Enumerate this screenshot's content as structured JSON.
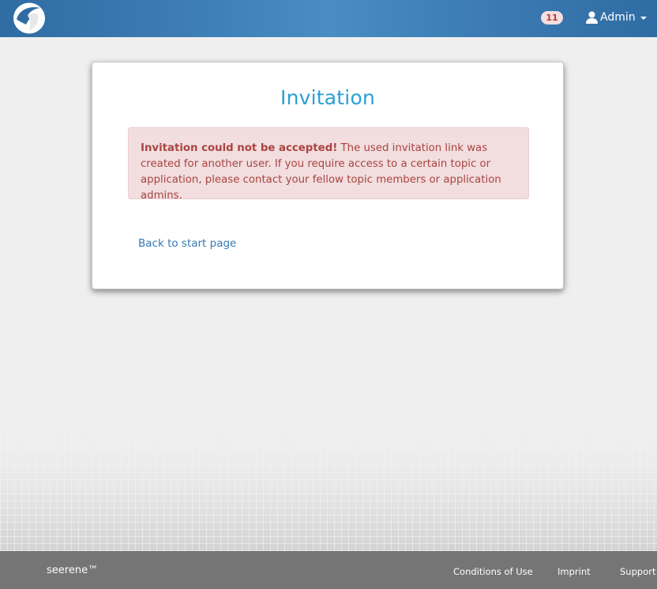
{
  "header": {
    "notification_count": "11",
    "user_label": "Admin",
    "icons": [
      "logo-icon",
      "user-icon",
      "caret-down-icon"
    ]
  },
  "card": {
    "title": "Invitation",
    "alert": {
      "strong": "Invitation could not be accepted!",
      "message": " The used invitation link was created for another user. If you require access to a certain topic or application, please contact your fellow topic members or application admins."
    },
    "back_link": "Back to start page"
  },
  "footer": {
    "brand": "seerene™",
    "links": [
      "Conditions of Use",
      "Imprint",
      "Support"
    ]
  },
  "colors": {
    "navbar": "#3b7ab3",
    "title": "#2a9fd6",
    "alert_bg": "#f2dede",
    "alert_text": "#a94442",
    "link": "#337ab7",
    "footer": "#757575"
  }
}
